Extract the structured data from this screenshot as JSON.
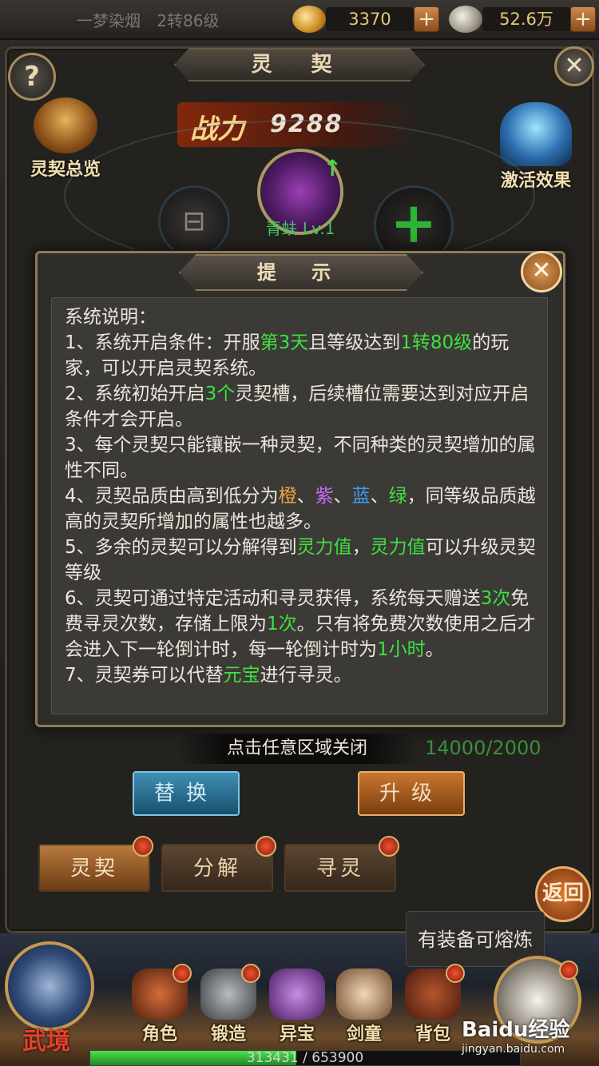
{
  "topbar": {
    "player_name": "一梦染烟",
    "player_level": "2转86级",
    "gold": "3370",
    "coins": "52.6万",
    "plus_label": "+"
  },
  "window": {
    "title": "灵 契",
    "help_label": "?",
    "close_label": "✕",
    "overview_label": "灵契总览",
    "activate_label": "激活效果",
    "power_label": "战力",
    "power_value": "9288",
    "slot_main_name": "青蚨 Lv.1",
    "add_label": "+",
    "lock_glyph": "⊟"
  },
  "dialog": {
    "title": "提 示",
    "close_label": "✕",
    "heading": "系统说明：",
    "lines": {
      "l1a": "1、系统开启条件：开服",
      "l1b": "第3天",
      "l1c": "且等级达到",
      "l1d": "1转80级",
      "l1e": "的玩家，可以开启灵契系统。",
      "l2a": "2、系统初始开启",
      "l2b": "3个",
      "l2c": "灵契槽，后续槽位需要达到对应开启条件才会开启。",
      "l3": "3、每个灵契只能镶嵌一种灵契，不同种类的灵契增加的属性不同。",
      "l4a": "4、灵契品质由高到低分为",
      "l4b": "橙",
      "l4c": "、",
      "l4d": "紫",
      "l4e": "、",
      "l4f": "蓝",
      "l4g": "、",
      "l4h": "绿",
      "l4i": "，同等级品质越高的灵契所增加的属性也越多。",
      "l5a": "5、多余的灵契可以分解得到",
      "l5b": "灵力值",
      "l5c": "，",
      "l5d": "灵力值",
      "l5e": "可以升级灵契等级",
      "l6a": "6、灵契可通过特定活动和寻灵获得，系统每天赠送",
      "l6b": "3次",
      "l6c": "免费寻灵次数，存储上限为",
      "l6d": "1次",
      "l6e": "。只有将免费次数使用之后才会进入下一轮倒计时，每一轮倒计时为",
      "l6f": "1小时",
      "l6g": "。",
      "l7a": "7、灵契券可以代替",
      "l7b": "元宝",
      "l7c": "进行寻灵。"
    }
  },
  "tap_close": "点击任意区域关闭",
  "spirit_count": "14000/2000",
  "actions": {
    "replace": "替换",
    "upgrade": "升级"
  },
  "tabs": {
    "spirit": "灵契",
    "decompose": "分解",
    "seek": "寻灵"
  },
  "back_label": "返回",
  "tooltip": "有装备可熔炼",
  "nav": {
    "wujing": "武境",
    "role": "角色",
    "forge": "锻造",
    "treasure": "异宝",
    "child": "剑童",
    "bag": "背包"
  },
  "exp": {
    "current": "313431",
    "max": "653900",
    "text": "313431 / 653900",
    "fraction": 0.479
  },
  "watermark": {
    "brand": "Baidu经验",
    "url": "jingyan.baidu.com"
  },
  "colors": {
    "highlight_green": "#3fe040",
    "orange": "#f2a33a",
    "purple": "#c46bf0",
    "blue": "#3d9cf5"
  }
}
